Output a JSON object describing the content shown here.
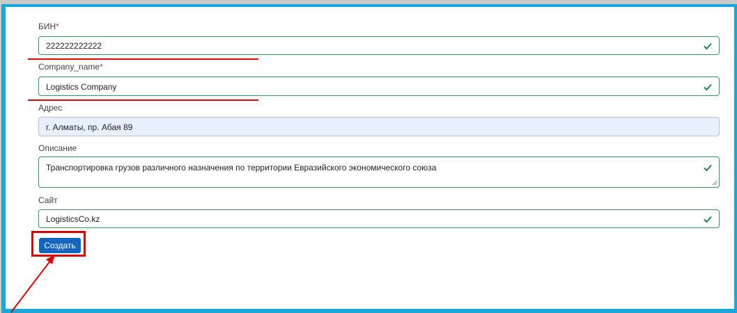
{
  "form": {
    "bin": {
      "label": "БИН",
      "required": "*",
      "value": "222222222222"
    },
    "company_name": {
      "label": "Company_name",
      "required": "*",
      "value": "Logistics Company"
    },
    "address": {
      "label": "Адрес",
      "value": "г. Алматы, пр. Абая 89"
    },
    "description": {
      "label": "Описание",
      "value": "Транспортировка грузов различного назначения по территории Евразийского экономического союза"
    },
    "site": {
      "label": "Сайт",
      "value": "LogisticsCo.kz"
    },
    "submit_label": "Создать"
  },
  "colors": {
    "valid_border": "#2e9d5a",
    "button_bg": "#1565c0",
    "annotation_red": "#e00000",
    "frame_accent": "#1aa6d6"
  },
  "icons": [
    "check-icon",
    "resize-grip-icon",
    "annotation-arrow"
  ]
}
